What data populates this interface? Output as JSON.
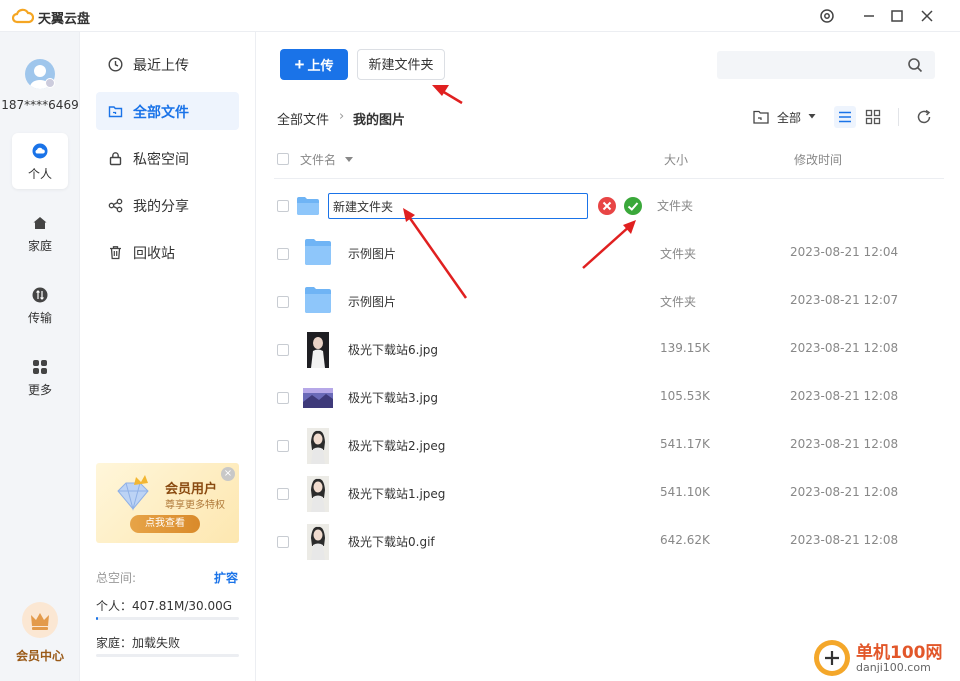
{
  "window": {
    "title": "天翼云盘"
  },
  "user": {
    "phone": "187****6469"
  },
  "rail": {
    "items": [
      {
        "label": "个人",
        "icon": "cloud-icon"
      },
      {
        "label": "家庭",
        "icon": "home-icon"
      },
      {
        "label": "传输",
        "icon": "transfer-icon"
      },
      {
        "label": "更多",
        "icon": "grid-icon"
      }
    ],
    "vip_label": "会员中心"
  },
  "sidebar": {
    "items": [
      {
        "label": "最近上传",
        "icon": "clock-icon"
      },
      {
        "label": "全部文件",
        "icon": "folder-icon"
      },
      {
        "label": "私密空间",
        "icon": "lock-icon"
      },
      {
        "label": "我的分享",
        "icon": "share-icon"
      },
      {
        "label": "回收站",
        "icon": "trash-icon"
      }
    ],
    "active": "全部文件"
  },
  "promo": {
    "title": "会员用户",
    "subtitle": "尊享更多特权",
    "button": "点我查看",
    "close": "×"
  },
  "storage": {
    "total_label": "总空间:",
    "expand_label": "扩容",
    "personal": "个人：407.81M/30.00G",
    "personal_fraction": 0.013,
    "family": "家庭：加载失败"
  },
  "toolbar": {
    "upload_label": "上传",
    "upload_plus": "+",
    "new_folder_label": "新建文件夹",
    "search_placeholder": ""
  },
  "breadcrumb": {
    "root": "全部文件",
    "sep": "›",
    "current": "我的图片"
  },
  "view": {
    "filter_label": "全部"
  },
  "table": {
    "headers": {
      "name": "文件名",
      "size": "大小",
      "modified": "修改时间"
    },
    "rename_row": {
      "value": "新建文件夹",
      "type": "文件夹"
    },
    "rows": [
      {
        "name": "示例图片",
        "size": "文件夹",
        "date": "2023-08-21 12:04",
        "kind": "folder"
      },
      {
        "name": "示例图片",
        "size": "文件夹",
        "date": "2023-08-21 12:07",
        "kind": "folder"
      },
      {
        "name": "极光下载站6.jpg",
        "size": "139.15K",
        "date": "2023-08-21 12:08",
        "kind": "portrait-dark"
      },
      {
        "name": "极光下载站3.jpg",
        "size": "105.53K",
        "date": "2023-08-21 12:08",
        "kind": "landscape-purple"
      },
      {
        "name": "极光下载站2.jpeg",
        "size": "541.17K",
        "date": "2023-08-21 12:08",
        "kind": "portrait-light"
      },
      {
        "name": "极光下载站1.jpeg",
        "size": "541.10K",
        "date": "2023-08-21 12:08",
        "kind": "portrait-light"
      },
      {
        "name": "极光下载站0.gif",
        "size": "642.62K",
        "date": "2023-08-21 12:08",
        "kind": "portrait-light"
      }
    ]
  },
  "watermark": {
    "title": "单机100网",
    "url": "danji100.com"
  },
  "colors": {
    "accent": "#1a73e8",
    "annotation_arrow": "#e02020",
    "confirm": "#3aa83a",
    "cancel": "#e84545"
  }
}
